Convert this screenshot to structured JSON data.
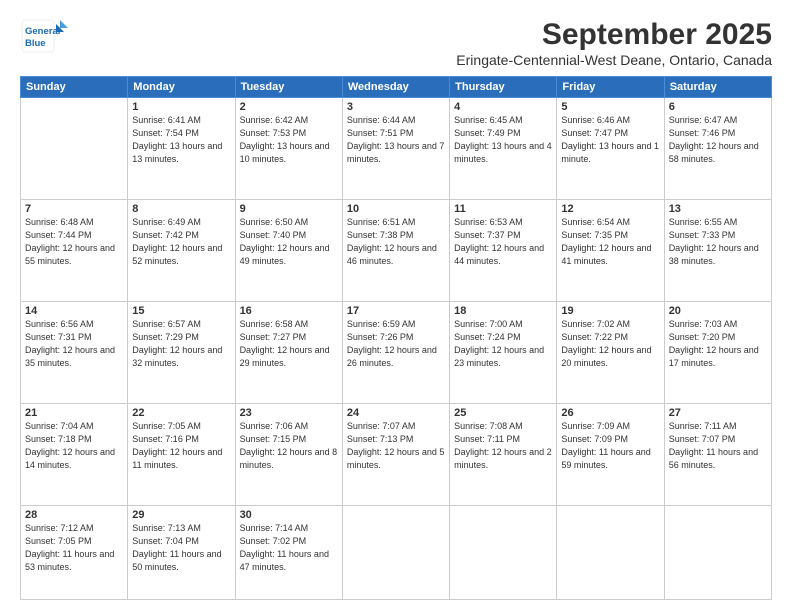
{
  "header": {
    "logo_line1": "General",
    "logo_line2": "Blue",
    "month": "September 2025",
    "location": "Eringate-Centennial-West Deane, Ontario, Canada"
  },
  "weekdays": [
    "Sunday",
    "Monday",
    "Tuesday",
    "Wednesday",
    "Thursday",
    "Friday",
    "Saturday"
  ],
  "weeks": [
    [
      {
        "day": "",
        "sunrise": "",
        "sunset": "",
        "daylight": ""
      },
      {
        "day": "1",
        "sunrise": "Sunrise: 6:41 AM",
        "sunset": "Sunset: 7:54 PM",
        "daylight": "Daylight: 13 hours and 13 minutes."
      },
      {
        "day": "2",
        "sunrise": "Sunrise: 6:42 AM",
        "sunset": "Sunset: 7:53 PM",
        "daylight": "Daylight: 13 hours and 10 minutes."
      },
      {
        "day": "3",
        "sunrise": "Sunrise: 6:44 AM",
        "sunset": "Sunset: 7:51 PM",
        "daylight": "Daylight: 13 hours and 7 minutes."
      },
      {
        "day": "4",
        "sunrise": "Sunrise: 6:45 AM",
        "sunset": "Sunset: 7:49 PM",
        "daylight": "Daylight: 13 hours and 4 minutes."
      },
      {
        "day": "5",
        "sunrise": "Sunrise: 6:46 AM",
        "sunset": "Sunset: 7:47 PM",
        "daylight": "Daylight: 13 hours and 1 minute."
      },
      {
        "day": "6",
        "sunrise": "Sunrise: 6:47 AM",
        "sunset": "Sunset: 7:46 PM",
        "daylight": "Daylight: 12 hours and 58 minutes."
      }
    ],
    [
      {
        "day": "7",
        "sunrise": "Sunrise: 6:48 AM",
        "sunset": "Sunset: 7:44 PM",
        "daylight": "Daylight: 12 hours and 55 minutes."
      },
      {
        "day": "8",
        "sunrise": "Sunrise: 6:49 AM",
        "sunset": "Sunset: 7:42 PM",
        "daylight": "Daylight: 12 hours and 52 minutes."
      },
      {
        "day": "9",
        "sunrise": "Sunrise: 6:50 AM",
        "sunset": "Sunset: 7:40 PM",
        "daylight": "Daylight: 12 hours and 49 minutes."
      },
      {
        "day": "10",
        "sunrise": "Sunrise: 6:51 AM",
        "sunset": "Sunset: 7:38 PM",
        "daylight": "Daylight: 12 hours and 46 minutes."
      },
      {
        "day": "11",
        "sunrise": "Sunrise: 6:53 AM",
        "sunset": "Sunset: 7:37 PM",
        "daylight": "Daylight: 12 hours and 44 minutes."
      },
      {
        "day": "12",
        "sunrise": "Sunrise: 6:54 AM",
        "sunset": "Sunset: 7:35 PM",
        "daylight": "Daylight: 12 hours and 41 minutes."
      },
      {
        "day": "13",
        "sunrise": "Sunrise: 6:55 AM",
        "sunset": "Sunset: 7:33 PM",
        "daylight": "Daylight: 12 hours and 38 minutes."
      }
    ],
    [
      {
        "day": "14",
        "sunrise": "Sunrise: 6:56 AM",
        "sunset": "Sunset: 7:31 PM",
        "daylight": "Daylight: 12 hours and 35 minutes."
      },
      {
        "day": "15",
        "sunrise": "Sunrise: 6:57 AM",
        "sunset": "Sunset: 7:29 PM",
        "daylight": "Daylight: 12 hours and 32 minutes."
      },
      {
        "day": "16",
        "sunrise": "Sunrise: 6:58 AM",
        "sunset": "Sunset: 7:27 PM",
        "daylight": "Daylight: 12 hours and 29 minutes."
      },
      {
        "day": "17",
        "sunrise": "Sunrise: 6:59 AM",
        "sunset": "Sunset: 7:26 PM",
        "daylight": "Daylight: 12 hours and 26 minutes."
      },
      {
        "day": "18",
        "sunrise": "Sunrise: 7:00 AM",
        "sunset": "Sunset: 7:24 PM",
        "daylight": "Daylight: 12 hours and 23 minutes."
      },
      {
        "day": "19",
        "sunrise": "Sunrise: 7:02 AM",
        "sunset": "Sunset: 7:22 PM",
        "daylight": "Daylight: 12 hours and 20 minutes."
      },
      {
        "day": "20",
        "sunrise": "Sunrise: 7:03 AM",
        "sunset": "Sunset: 7:20 PM",
        "daylight": "Daylight: 12 hours and 17 minutes."
      }
    ],
    [
      {
        "day": "21",
        "sunrise": "Sunrise: 7:04 AM",
        "sunset": "Sunset: 7:18 PM",
        "daylight": "Daylight: 12 hours and 14 minutes."
      },
      {
        "day": "22",
        "sunrise": "Sunrise: 7:05 AM",
        "sunset": "Sunset: 7:16 PM",
        "daylight": "Daylight: 12 hours and 11 minutes."
      },
      {
        "day": "23",
        "sunrise": "Sunrise: 7:06 AM",
        "sunset": "Sunset: 7:15 PM",
        "daylight": "Daylight: 12 hours and 8 minutes."
      },
      {
        "day": "24",
        "sunrise": "Sunrise: 7:07 AM",
        "sunset": "Sunset: 7:13 PM",
        "daylight": "Daylight: 12 hours and 5 minutes."
      },
      {
        "day": "25",
        "sunrise": "Sunrise: 7:08 AM",
        "sunset": "Sunset: 7:11 PM",
        "daylight": "Daylight: 12 hours and 2 minutes."
      },
      {
        "day": "26",
        "sunrise": "Sunrise: 7:09 AM",
        "sunset": "Sunset: 7:09 PM",
        "daylight": "Daylight: 11 hours and 59 minutes."
      },
      {
        "day": "27",
        "sunrise": "Sunrise: 7:11 AM",
        "sunset": "Sunset: 7:07 PM",
        "daylight": "Daylight: 11 hours and 56 minutes."
      }
    ],
    [
      {
        "day": "28",
        "sunrise": "Sunrise: 7:12 AM",
        "sunset": "Sunset: 7:05 PM",
        "daylight": "Daylight: 11 hours and 53 minutes."
      },
      {
        "day": "29",
        "sunrise": "Sunrise: 7:13 AM",
        "sunset": "Sunset: 7:04 PM",
        "daylight": "Daylight: 11 hours and 50 minutes."
      },
      {
        "day": "30",
        "sunrise": "Sunrise: 7:14 AM",
        "sunset": "Sunset: 7:02 PM",
        "daylight": "Daylight: 11 hours and 47 minutes."
      },
      {
        "day": "",
        "sunrise": "",
        "sunset": "",
        "daylight": ""
      },
      {
        "day": "",
        "sunrise": "",
        "sunset": "",
        "daylight": ""
      },
      {
        "day": "",
        "sunrise": "",
        "sunset": "",
        "daylight": ""
      },
      {
        "day": "",
        "sunrise": "",
        "sunset": "",
        "daylight": ""
      }
    ]
  ]
}
